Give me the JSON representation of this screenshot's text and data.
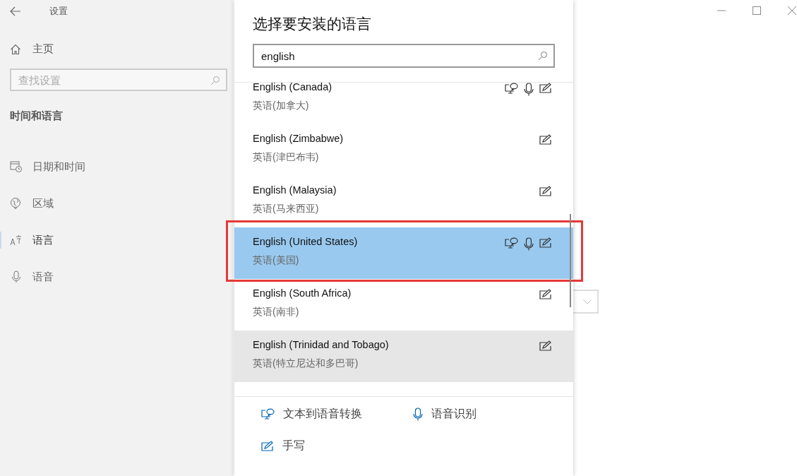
{
  "settings": {
    "title": "设置",
    "home": "主页",
    "search": {
      "placeholder": "查找设置"
    },
    "section_title": "时间和语言",
    "nav_items": [
      {
        "label": "日期和时间",
        "kind": "calendar",
        "selected": false
      },
      {
        "label": "区域",
        "kind": "globe",
        "selected": false
      },
      {
        "label": "语言",
        "kind": "language",
        "selected": true
      },
      {
        "label": "语音",
        "kind": "mic",
        "selected": false
      }
    ]
  },
  "dialog": {
    "title": "选择要安装的语言",
    "search": {
      "value": "english"
    },
    "languages": [
      {
        "name": "English (Canada)",
        "native": "英语(加拿大)",
        "tts": true,
        "speech": true,
        "handwriting": true,
        "selected": false,
        "hovered": false,
        "highlighted": false
      },
      {
        "name": "English (Zimbabwe)",
        "native": "英语(津巴布韦)",
        "tts": false,
        "speech": false,
        "handwriting": true,
        "selected": false,
        "hovered": false,
        "highlighted": false
      },
      {
        "name": "English (Malaysia)",
        "native": "英语(马来西亚)",
        "tts": false,
        "speech": false,
        "handwriting": true,
        "selected": false,
        "hovered": false,
        "highlighted": false
      },
      {
        "name": "English (United States)",
        "native": "英语(美国)",
        "tts": true,
        "speech": true,
        "handwriting": true,
        "selected": true,
        "hovered": false,
        "highlighted": true
      },
      {
        "name": "English (South Africa)",
        "native": "英语(南非)",
        "tts": false,
        "speech": false,
        "handwriting": true,
        "selected": false,
        "hovered": false,
        "highlighted": false
      },
      {
        "name": "English (Trinidad and Tobago)",
        "native": "英语(特立尼达和多巴哥)",
        "tts": false,
        "speech": false,
        "handwriting": true,
        "selected": false,
        "hovered": true,
        "highlighted": false
      }
    ],
    "legend": [
      {
        "kind": "tts",
        "label": "文本到语音转换"
      },
      {
        "kind": "speech",
        "label": "语音识别"
      },
      {
        "kind": "handwriting",
        "label": "手写"
      }
    ]
  }
}
